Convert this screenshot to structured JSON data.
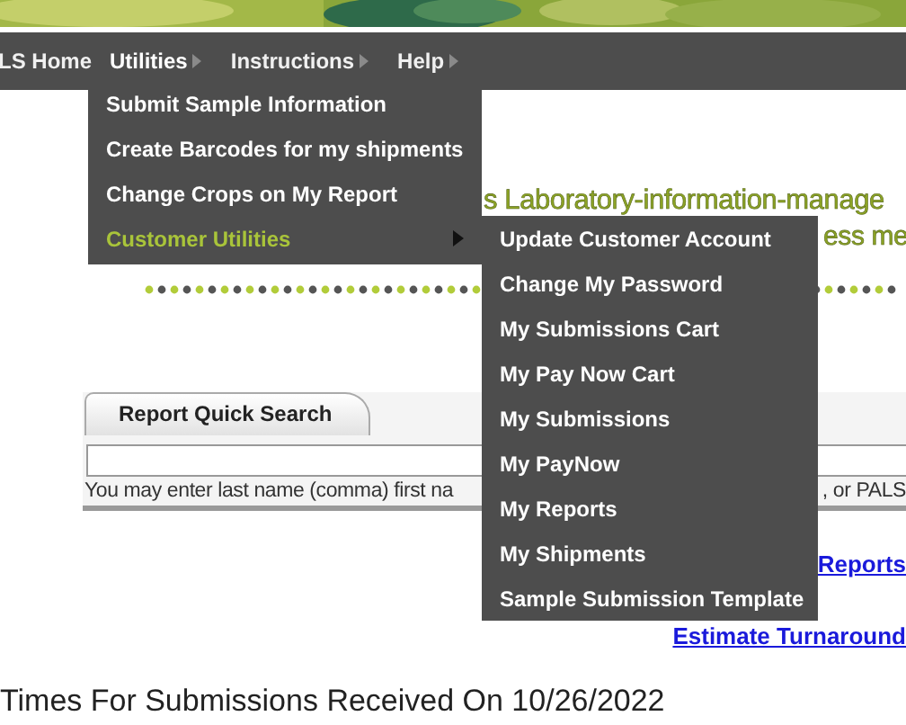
{
  "nav": [
    {
      "label": "LS Home",
      "has_submenu": false,
      "open": false
    },
    {
      "label": "Utilities",
      "has_submenu": true,
      "open": true
    },
    {
      "label": "Instructions",
      "has_submenu": true,
      "open": false
    },
    {
      "label": "Help",
      "has_submenu": true,
      "open": false
    }
  ],
  "utilities_menu": [
    {
      "label": "Submit Sample Information",
      "selected": false,
      "has_submenu": false
    },
    {
      "label": "Create Barcodes for my shipments",
      "selected": false,
      "has_submenu": false
    },
    {
      "label": "Change Crops on My Report",
      "selected": false,
      "has_submenu": false
    },
    {
      "label": "Customer Utilities",
      "selected": true,
      "has_submenu": true
    }
  ],
  "customer_utilities_menu": [
    "Update Customer Account",
    "Change My Password",
    "My Submissions Cart",
    "My Pay Now Cart",
    "My Submissions",
    "My PayNow",
    "My Reports",
    "My Shipments",
    "Sample Submission Template"
  ],
  "heading": [
    "s Laboratory-information-manage",
    "ess me"
  ],
  "quick_search": {
    "tab": "Report Quick Search",
    "hint_start": "You may enter last name (comma) first na",
    "hint_end": ", or PALS"
  },
  "links": [
    "Reports",
    "Estimate Turnaround"
  ],
  "footer_heading": "Times For Submissions Received On 10/26/2022"
}
